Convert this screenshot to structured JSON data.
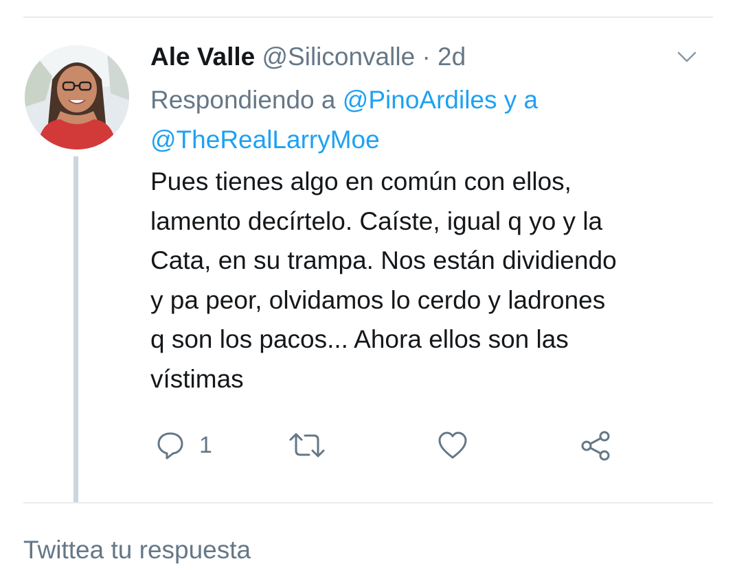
{
  "tweet": {
    "author_name": "Ale Valle",
    "author_handle": "@Siliconvalle",
    "separator": "·",
    "time_ago": "2d",
    "reply_prefix": "Respondiendo a",
    "reply_mention_1": "@PinoArdiles",
    "reply_joiner": "y a",
    "reply_mention_2": "@TheRealLarryMoe",
    "text": "Pues tienes algo en común con ellos,\nlamento decírtelo. Caíste, igual q yo y la\nCata, en su trampa. Nos están dividiendo\ny pa peor, olvidamos lo cerdo y ladrones\nq son los pacos... Ahora ellos son las\nvístimas",
    "actions": {
      "reply_icon": "reply-bubble-icon",
      "reply_count": "1",
      "retweet_icon": "retweet-icon",
      "like_icon": "heart-icon",
      "share_icon": "share-icon"
    }
  },
  "compose": {
    "placeholder": "Twittea tu respuesta"
  },
  "colors": {
    "text": "#14171a",
    "secondary": "#657786",
    "link": "#1da1f2",
    "divider": "#e6ecf0",
    "thread_line": "#ccd6dd"
  }
}
